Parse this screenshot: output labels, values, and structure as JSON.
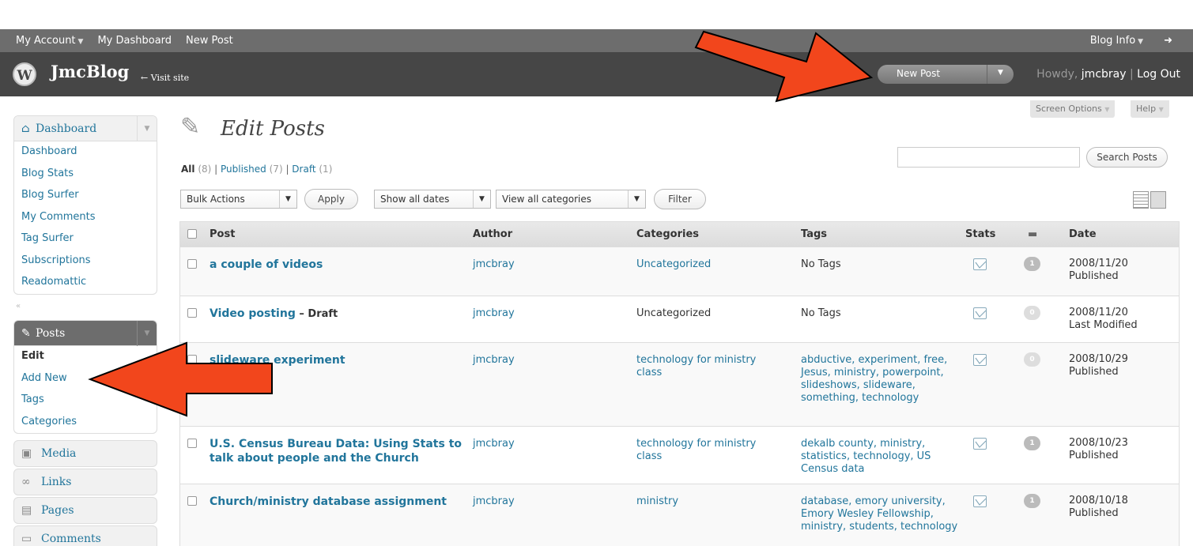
{
  "adminbar": {
    "my_account": "My Account",
    "my_dashboard": "My Dashboard",
    "new_post": "New Post",
    "blog_info": "Blog Info",
    "arrow": "➜"
  },
  "header": {
    "logo": "W",
    "blog_name": "JmcBlog",
    "visit_site": "← Visit site",
    "fav_button": "New Post",
    "howdy_prefix": "Howdy, ",
    "user": "jmcbray",
    "sep": " | ",
    "logout": "Log Out"
  },
  "screen_options": {
    "label": "Screen Options",
    "help": "Help"
  },
  "sidebar": {
    "dashboard": {
      "title": "Dashboard",
      "items": [
        "Dashboard",
        "Blog Stats",
        "Blog Surfer",
        "My Comments",
        "Tag Surfer",
        "Subscriptions",
        "Readomattic"
      ]
    },
    "collapse": "«",
    "posts": {
      "title": "Posts",
      "items": [
        "Edit",
        "Add New",
        "Tags",
        "Categories"
      ]
    },
    "media": "Media",
    "links": "Links",
    "pages": "Pages",
    "comments": "Comments"
  },
  "main": {
    "title": "Edit Posts",
    "filters": {
      "all": "All",
      "all_count": "(8)",
      "published": "Published",
      "published_count": "(7)",
      "draft": "Draft",
      "draft_count": "(1)",
      "sep": " | "
    },
    "search_button": "Search Posts",
    "bulk_actions": "Bulk Actions",
    "apply": "Apply",
    "dates": "Show all dates",
    "categories": "View all categories",
    "filter": "Filter"
  },
  "table": {
    "columns": {
      "post": "Post",
      "author": "Author",
      "categories": "Categories",
      "tags": "Tags",
      "stats": "Stats",
      "date": "Date"
    },
    "rows": [
      {
        "title": "a couple of videos",
        "draft": "",
        "author": "jmcbray",
        "categories": "Uncategorized",
        "tags": "No Tags",
        "comments": "1",
        "date": "2008/11/20",
        "status": "Published"
      },
      {
        "title": "Video posting",
        "draft": " – Draft",
        "author": "jmcbray",
        "categories": "Uncategorized",
        "tags": "No Tags",
        "comments": "0",
        "date": "2008/11/20",
        "status": "Last Modified"
      },
      {
        "title": "slideware experiment",
        "draft": "",
        "author": "jmcbray",
        "categories": "technology for ministry class",
        "tags": "abductive, experiment, free, Jesus, ministry, powerpoint, slideshows, slideware, something, technology",
        "comments": "0",
        "date": "2008/10/29",
        "status": "Published"
      },
      {
        "title": "U.S. Census Bureau Data: Using Stats to talk about people and the Church",
        "draft": "",
        "author": "jmcbray",
        "categories": "technology for ministry class",
        "tags": "dekalb county, ministry, statistics, technology, US Census data",
        "comments": "1",
        "date": "2008/10/23",
        "status": "Published"
      },
      {
        "title": "Church/ministry database assignment",
        "draft": "",
        "author": "jmcbray",
        "categories": "ministry",
        "tags": "database, emory university, Emory Wesley Fellowship, ministry, students, technology",
        "comments": "1",
        "date": "2008/10/18",
        "status": "Published"
      }
    ]
  },
  "colors": {
    "accent": "#21759b",
    "header": "#464646",
    "adminbar": "#6d6d6d",
    "arrow": "#f2461c"
  },
  "icons": [
    "wordpress-logo",
    "house-icon",
    "pushpin-icon",
    "media-icon",
    "links-icon",
    "pages-icon",
    "comments-icon",
    "stats-icon",
    "comment-bubble-icon"
  ]
}
